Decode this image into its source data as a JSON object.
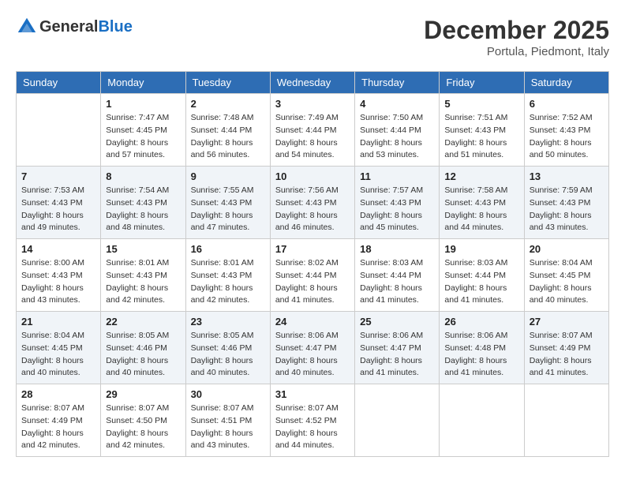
{
  "header": {
    "logo_general": "General",
    "logo_blue": "Blue",
    "month_title": "December 2025",
    "location": "Portula, Piedmont, Italy"
  },
  "days_of_week": [
    "Sunday",
    "Monday",
    "Tuesday",
    "Wednesday",
    "Thursday",
    "Friday",
    "Saturday"
  ],
  "weeks": [
    [
      {
        "day": "",
        "info": ""
      },
      {
        "day": "1",
        "info": "Sunrise: 7:47 AM\nSunset: 4:45 PM\nDaylight: 8 hours\nand 57 minutes."
      },
      {
        "day": "2",
        "info": "Sunrise: 7:48 AM\nSunset: 4:44 PM\nDaylight: 8 hours\nand 56 minutes."
      },
      {
        "day": "3",
        "info": "Sunrise: 7:49 AM\nSunset: 4:44 PM\nDaylight: 8 hours\nand 54 minutes."
      },
      {
        "day": "4",
        "info": "Sunrise: 7:50 AM\nSunset: 4:44 PM\nDaylight: 8 hours\nand 53 minutes."
      },
      {
        "day": "5",
        "info": "Sunrise: 7:51 AM\nSunset: 4:43 PM\nDaylight: 8 hours\nand 51 minutes."
      },
      {
        "day": "6",
        "info": "Sunrise: 7:52 AM\nSunset: 4:43 PM\nDaylight: 8 hours\nand 50 minutes."
      }
    ],
    [
      {
        "day": "7",
        "info": "Sunrise: 7:53 AM\nSunset: 4:43 PM\nDaylight: 8 hours\nand 49 minutes."
      },
      {
        "day": "8",
        "info": "Sunrise: 7:54 AM\nSunset: 4:43 PM\nDaylight: 8 hours\nand 48 minutes."
      },
      {
        "day": "9",
        "info": "Sunrise: 7:55 AM\nSunset: 4:43 PM\nDaylight: 8 hours\nand 47 minutes."
      },
      {
        "day": "10",
        "info": "Sunrise: 7:56 AM\nSunset: 4:43 PM\nDaylight: 8 hours\nand 46 minutes."
      },
      {
        "day": "11",
        "info": "Sunrise: 7:57 AM\nSunset: 4:43 PM\nDaylight: 8 hours\nand 45 minutes."
      },
      {
        "day": "12",
        "info": "Sunrise: 7:58 AM\nSunset: 4:43 PM\nDaylight: 8 hours\nand 44 minutes."
      },
      {
        "day": "13",
        "info": "Sunrise: 7:59 AM\nSunset: 4:43 PM\nDaylight: 8 hours\nand 43 minutes."
      }
    ],
    [
      {
        "day": "14",
        "info": "Sunrise: 8:00 AM\nSunset: 4:43 PM\nDaylight: 8 hours\nand 43 minutes."
      },
      {
        "day": "15",
        "info": "Sunrise: 8:01 AM\nSunset: 4:43 PM\nDaylight: 8 hours\nand 42 minutes."
      },
      {
        "day": "16",
        "info": "Sunrise: 8:01 AM\nSunset: 4:43 PM\nDaylight: 8 hours\nand 42 minutes."
      },
      {
        "day": "17",
        "info": "Sunrise: 8:02 AM\nSunset: 4:44 PM\nDaylight: 8 hours\nand 41 minutes."
      },
      {
        "day": "18",
        "info": "Sunrise: 8:03 AM\nSunset: 4:44 PM\nDaylight: 8 hours\nand 41 minutes."
      },
      {
        "day": "19",
        "info": "Sunrise: 8:03 AM\nSunset: 4:44 PM\nDaylight: 8 hours\nand 41 minutes."
      },
      {
        "day": "20",
        "info": "Sunrise: 8:04 AM\nSunset: 4:45 PM\nDaylight: 8 hours\nand 40 minutes."
      }
    ],
    [
      {
        "day": "21",
        "info": "Sunrise: 8:04 AM\nSunset: 4:45 PM\nDaylight: 8 hours\nand 40 minutes."
      },
      {
        "day": "22",
        "info": "Sunrise: 8:05 AM\nSunset: 4:46 PM\nDaylight: 8 hours\nand 40 minutes."
      },
      {
        "day": "23",
        "info": "Sunrise: 8:05 AM\nSunset: 4:46 PM\nDaylight: 8 hours\nand 40 minutes."
      },
      {
        "day": "24",
        "info": "Sunrise: 8:06 AM\nSunset: 4:47 PM\nDaylight: 8 hours\nand 40 minutes."
      },
      {
        "day": "25",
        "info": "Sunrise: 8:06 AM\nSunset: 4:47 PM\nDaylight: 8 hours\nand 41 minutes."
      },
      {
        "day": "26",
        "info": "Sunrise: 8:06 AM\nSunset: 4:48 PM\nDaylight: 8 hours\nand 41 minutes."
      },
      {
        "day": "27",
        "info": "Sunrise: 8:07 AM\nSunset: 4:49 PM\nDaylight: 8 hours\nand 41 minutes."
      }
    ],
    [
      {
        "day": "28",
        "info": "Sunrise: 8:07 AM\nSunset: 4:49 PM\nDaylight: 8 hours\nand 42 minutes."
      },
      {
        "day": "29",
        "info": "Sunrise: 8:07 AM\nSunset: 4:50 PM\nDaylight: 8 hours\nand 42 minutes."
      },
      {
        "day": "30",
        "info": "Sunrise: 8:07 AM\nSunset: 4:51 PM\nDaylight: 8 hours\nand 43 minutes."
      },
      {
        "day": "31",
        "info": "Sunrise: 8:07 AM\nSunset: 4:52 PM\nDaylight: 8 hours\nand 44 minutes."
      },
      {
        "day": "",
        "info": ""
      },
      {
        "day": "",
        "info": ""
      },
      {
        "day": "",
        "info": ""
      }
    ]
  ]
}
